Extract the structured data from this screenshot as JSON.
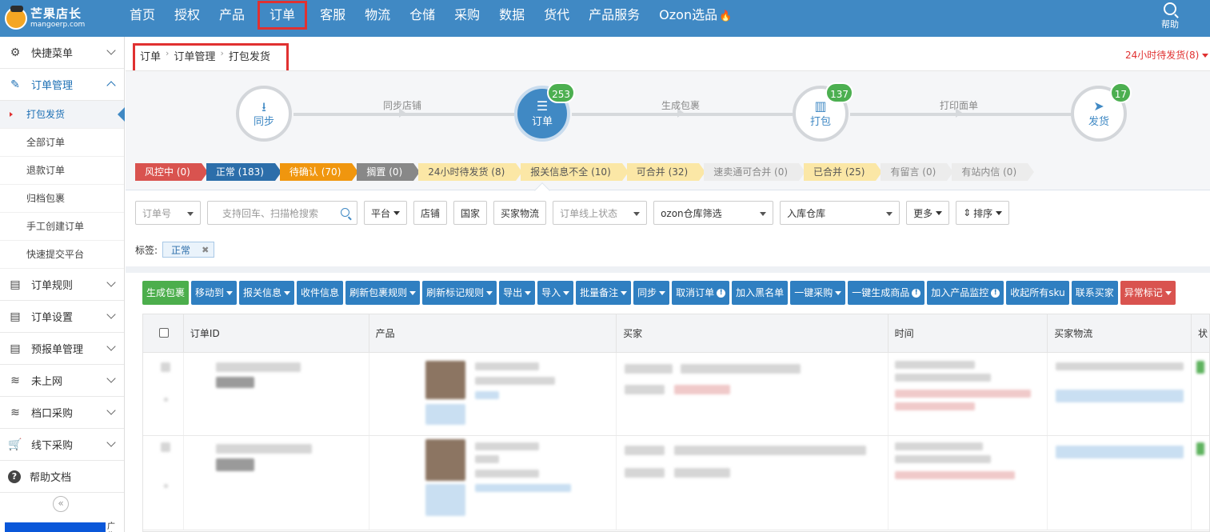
{
  "app": {
    "logo_cn": "芒果店长",
    "logo_en": "mangoerp.com"
  },
  "nav": {
    "items": [
      "首页",
      "授权",
      "产品",
      "订单",
      "客服",
      "物流",
      "仓储",
      "采购",
      "数据",
      "货代",
      "产品服务",
      "Ozon选品"
    ],
    "active": "订单",
    "help_label": "帮助"
  },
  "sidebar": {
    "items": [
      {
        "label": "快捷菜单",
        "icon": "gear-icon"
      },
      {
        "label": "订单管理",
        "icon": "edit-icon"
      },
      {
        "label": "订单规则",
        "icon": "clipboard-icon"
      },
      {
        "label": "订单设置",
        "icon": "clipboard-icon"
      },
      {
        "label": "预报单管理",
        "icon": "clipboard-icon"
      },
      {
        "label": "未上网",
        "icon": "wifi-icon"
      },
      {
        "label": "档口采购",
        "icon": "wifi-icon"
      },
      {
        "label": "线下采购",
        "icon": "cart-icon"
      },
      {
        "label": "帮助文档",
        "icon": "question-icon"
      }
    ],
    "sub_items": [
      "打包发货",
      "全部订单",
      "退款订单",
      "归档包裹",
      "手工创建订单",
      "快速提交平台"
    ],
    "collapse_label": "«",
    "ad_label": "广告"
  },
  "breadcrumb": [
    "订单",
    "订单管理",
    "打包发货"
  ],
  "alert": {
    "label": "24小时待发货(8)"
  },
  "flow": {
    "steps": [
      {
        "label": "同步",
        "badge": ""
      },
      {
        "label": "订单",
        "badge": "253"
      },
      {
        "label": "打包",
        "badge": "137"
      },
      {
        "label": "发货",
        "badge": "17"
      }
    ],
    "connectors": [
      "同步店铺",
      "生成包裹",
      "打印面单"
    ]
  },
  "status_tags": [
    {
      "label": "风控中 (0)",
      "style": "red"
    },
    {
      "label": "正常 (183)",
      "style": "blue"
    },
    {
      "label": "待确认 (70)",
      "style": "orange"
    },
    {
      "label": "搁置 (0)",
      "style": "gray"
    },
    {
      "label": "24小时待发货 (8)",
      "style": "yellow"
    },
    {
      "label": "报关信息不全 (10)",
      "style": "yellow"
    },
    {
      "label": "可合并 (32)",
      "style": "yellow"
    },
    {
      "label": "速卖通可合并 (0)",
      "style": "light"
    },
    {
      "label": "已合并 (25)",
      "style": "yellow"
    },
    {
      "label": "有留言 (0)",
      "style": "light"
    },
    {
      "label": "有站内信 (0)",
      "style": "light"
    }
  ],
  "filters": {
    "order_no": "订单号",
    "search_placeholder": "支持回车、扫描枪搜索",
    "platform": "平台",
    "shop": "店铺",
    "country": "国家",
    "buyer_logistics": "买家物流",
    "online_status": "订单线上状态",
    "ozon_warehouse": "ozon仓库筛选",
    "inbound_warehouse": "入库仓库",
    "more": "更多",
    "sort": "排序"
  },
  "labels": {
    "title": "标签:",
    "chip": "正常",
    "chip_close": "✖"
  },
  "toolbar": [
    {
      "label": "生成包裹",
      "style": "green",
      "dropdown": false,
      "info": false
    },
    {
      "label": "移动到",
      "style": "blue",
      "dropdown": true,
      "info": false
    },
    {
      "label": "报关信息",
      "style": "blue",
      "dropdown": true,
      "info": false
    },
    {
      "label": "收件信息",
      "style": "blue",
      "dropdown": false,
      "info": false
    },
    {
      "label": "刷新包裹规则",
      "style": "blue",
      "dropdown": true,
      "info": false
    },
    {
      "label": "刷新标记规则",
      "style": "blue",
      "dropdown": true,
      "info": false
    },
    {
      "label": "导出",
      "style": "blue",
      "dropdown": true,
      "info": false
    },
    {
      "label": "导入",
      "style": "blue",
      "dropdown": true,
      "info": false
    },
    {
      "label": "批量备注",
      "style": "blue",
      "dropdown": true,
      "info": false
    },
    {
      "label": "同步",
      "style": "blue",
      "dropdown": true,
      "info": false
    },
    {
      "label": "取消订单",
      "style": "blue",
      "dropdown": false,
      "info": true
    },
    {
      "label": "加入黑名单",
      "style": "blue",
      "dropdown": false,
      "info": false
    },
    {
      "label": "一键采购",
      "style": "blue",
      "dropdown": true,
      "info": false
    },
    {
      "label": "一键生成商品",
      "style": "blue",
      "dropdown": false,
      "info": true
    },
    {
      "label": "加入产品监控",
      "style": "blue",
      "dropdown": false,
      "info": true
    },
    {
      "label": "收起所有sku",
      "style": "blue",
      "dropdown": false,
      "info": false
    },
    {
      "label": "联系买家",
      "style": "blue",
      "dropdown": false,
      "info": false
    },
    {
      "label": "异常标记",
      "style": "danger",
      "dropdown": true,
      "info": false
    }
  ],
  "table": {
    "columns": [
      "订单ID",
      "产品",
      "买家",
      "时间",
      "买家物流",
      "状"
    ]
  },
  "colors": {
    "topbar": "#4089c4",
    "highlight": "#e03131",
    "primary_button": "#2f7fc1",
    "badge": "#4caf50"
  }
}
